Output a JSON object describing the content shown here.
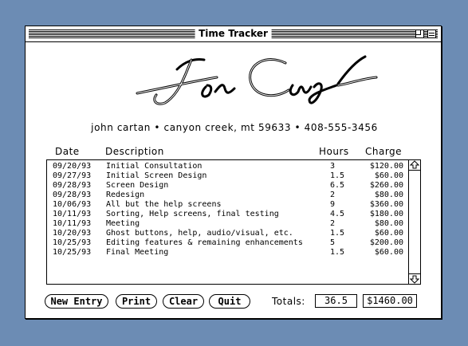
{
  "window": {
    "title": "Time Tracker"
  },
  "letterhead": {
    "signature": "John Cartan",
    "address": "john cartan • canyon creek, mt 59633 • 408-555-3456"
  },
  "columns": {
    "date": "Date",
    "description": "Description",
    "hours": "Hours",
    "charge": "Charge"
  },
  "entries": [
    {
      "date": "09/20/93",
      "description": "Initial Consultation",
      "hours": "3",
      "charge": "$120.00"
    },
    {
      "date": "09/27/93",
      "description": "Initial Screen Design",
      "hours": "1.5",
      "charge": "$60.00"
    },
    {
      "date": "09/28/93",
      "description": "Screen Design",
      "hours": "6.5",
      "charge": "$260.00"
    },
    {
      "date": "09/28/93",
      "description": "Redesign",
      "hours": "2",
      "charge": "$80.00"
    },
    {
      "date": "10/06/93",
      "description": "All but the help screens",
      "hours": "9",
      "charge": "$360.00"
    },
    {
      "date": "10/11/93",
      "description": "Sorting, Help screens, final testing",
      "hours": "4.5",
      "charge": "$180.00"
    },
    {
      "date": "10/11/93",
      "description": "Meeting",
      "hours": "2",
      "charge": "$80.00"
    },
    {
      "date": "10/20/93",
      "description": "Ghost buttons, help, audio/visual, etc.",
      "hours": "1.5",
      "charge": "$60.00"
    },
    {
      "date": "10/25/93",
      "description": "Editing features & remaining enhancements",
      "hours": "5",
      "charge": "$200.00"
    },
    {
      "date": "10/25/93",
      "description": "Final Meeting",
      "hours": "1.5",
      "charge": "$60.00"
    }
  ],
  "buttons": {
    "new_entry": "New Entry",
    "print": "Print",
    "clear": "Clear",
    "quit": "Quit"
  },
  "totals": {
    "label": "Totals:",
    "hours": "36.5",
    "charge": "$1460.00"
  },
  "icons": {
    "scroll_up": "scroll-up-arrow-icon",
    "scroll_down": "scroll-down-arrow-icon"
  },
  "colors": {
    "desktop": "#6c8cb4",
    "window": "#ffffff",
    "ink": "#000000"
  }
}
